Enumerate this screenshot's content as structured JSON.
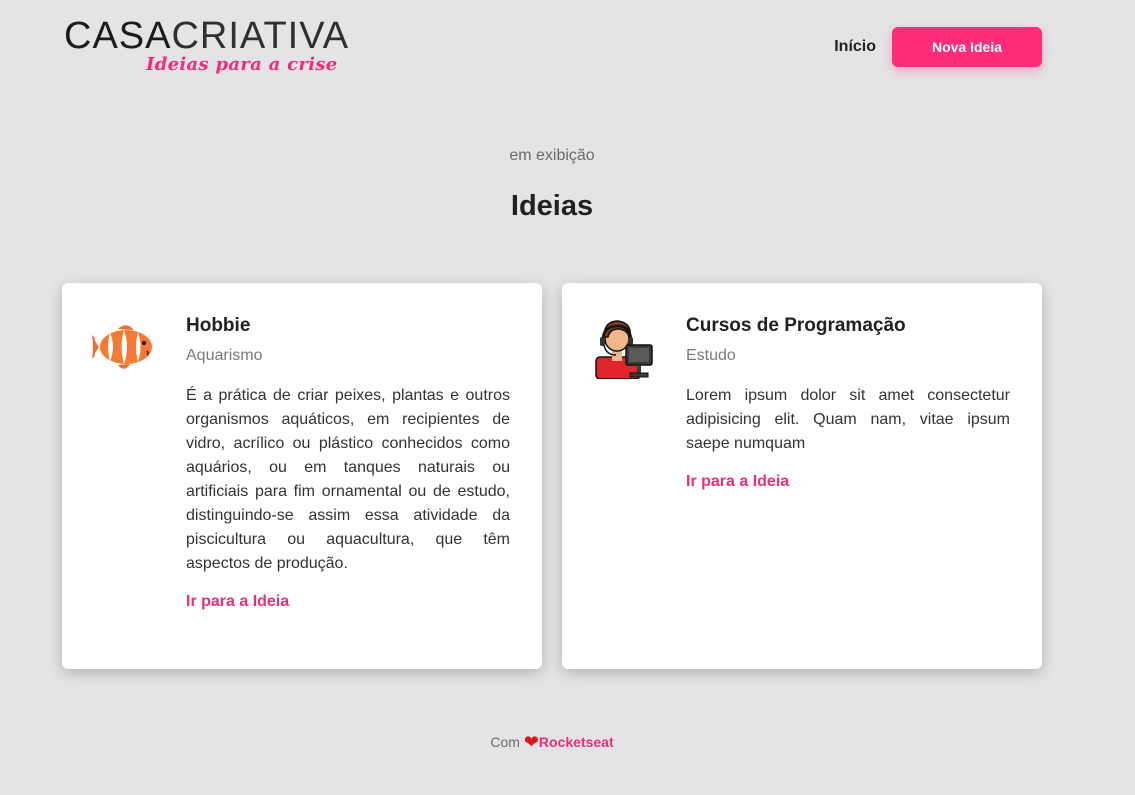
{
  "header": {
    "logo_main_bold": "CASA",
    "logo_main_light": "CRIATIVA",
    "logo_tagline": "Ideias para a crise",
    "nav_home": "Início",
    "nav_new_idea": "Nova Ideia"
  },
  "section": {
    "subtitle": "em exibição",
    "title": "Ideias"
  },
  "cards": [
    {
      "icon": "clownfish-icon",
      "title": "Hobbie",
      "category": "Aquarismo",
      "description": "É a prática de criar peixes, plantas e outros organismos aquáticos, em recipientes de vidro, acrílico ou plástico conhecidos como aquários, ou em tanques naturais ou artificiais para fim ornamental ou de estudo, distinguindo-se assim essa atividade da piscicultura ou aquacultura, que têm aspectos de produção.",
      "link": "Ir para a Ideia"
    },
    {
      "icon": "programmer-icon",
      "title": "Cursos de Programação",
      "category": "Estudo",
      "description": "Lorem ipsum dolor sit amet consectetur adipisicing elit. Quam nam, vitae ipsum saepe numquam",
      "link": "Ir para a Ideia"
    }
  ],
  "footer": {
    "prefix": "Com",
    "heart": "❤",
    "brand": "Rocketseat"
  },
  "colors": {
    "accent": "#ff2d77",
    "background": "#e4e4e6",
    "text": "#212121"
  }
}
